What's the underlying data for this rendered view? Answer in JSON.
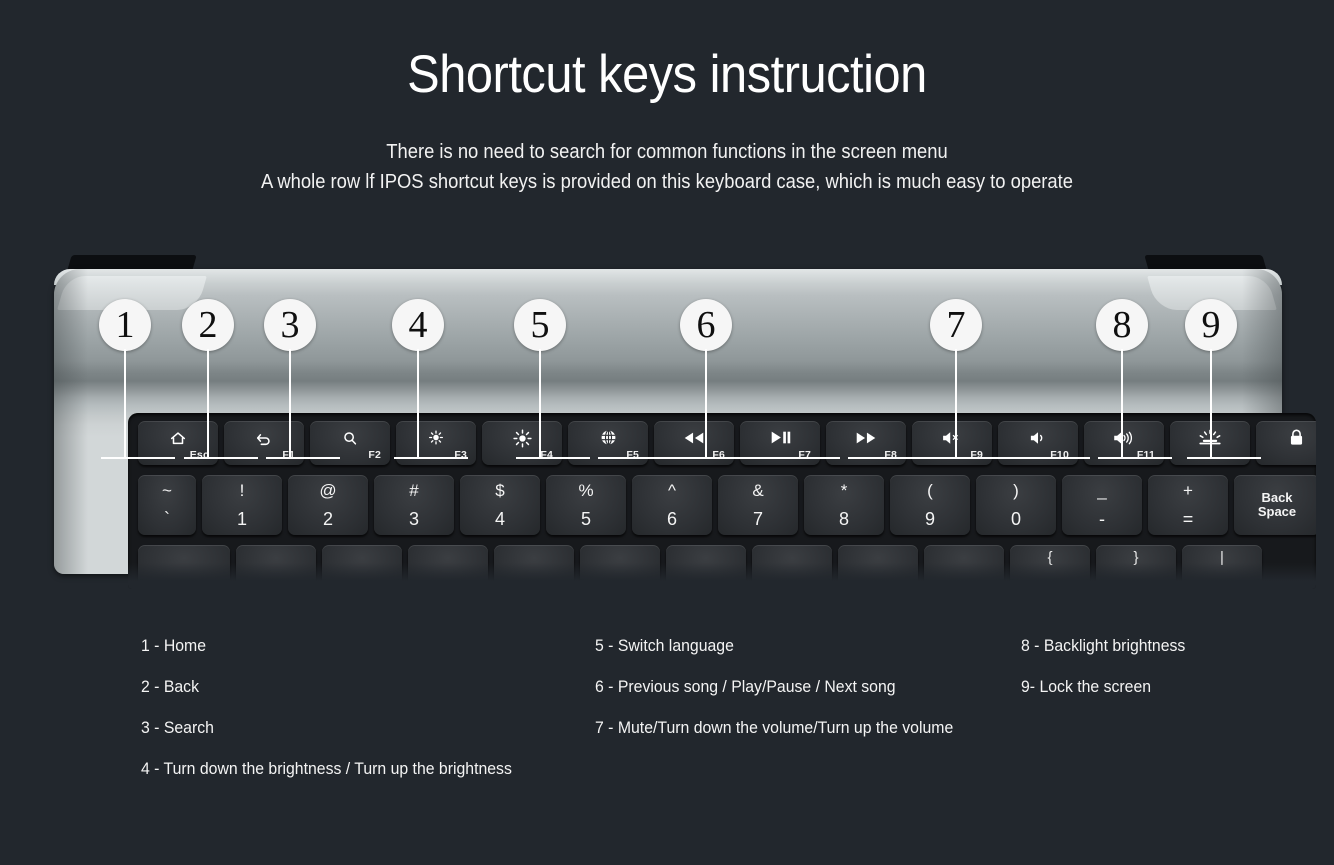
{
  "header": {
    "title": "Shortcut keys instruction",
    "subtitle_line1": "There is no need to search for common functions in the screen menu",
    "subtitle_line2": "A whole row lf IPOS shortcut keys is provided on this keyboard case, which is much easy to operate"
  },
  "colors": {
    "background": "#22272d",
    "text": "#ffffff",
    "callout_fill": "#f6f6f6",
    "callout_text": "#101010",
    "key_face": "#2e3135",
    "keyboard_body": "#b9bfc1",
    "deck": "#17191c"
  },
  "keyboard": {
    "function_row": [
      {
        "icon": "home-icon",
        "label": "Esc"
      },
      {
        "icon": "back-arrow-icon",
        "label": "F1"
      },
      {
        "icon": "search-icon",
        "label": "F2"
      },
      {
        "icon": "brightness-down-icon",
        "label": "F3"
      },
      {
        "icon": "brightness-up-icon",
        "label": "F4"
      },
      {
        "icon": "globe-icon",
        "label": "F5"
      },
      {
        "icon": "previous-track-icon",
        "label": "F6"
      },
      {
        "icon": "play-pause-icon",
        "label": "F7"
      },
      {
        "icon": "next-track-icon",
        "label": "F8"
      },
      {
        "icon": "volume-mute-icon",
        "label": "F9"
      },
      {
        "icon": "volume-down-icon",
        "label": "F10"
      },
      {
        "icon": "volume-up-icon",
        "label": "F11"
      },
      {
        "icon": "backlight-icon",
        "label": ""
      },
      {
        "icon": "lock-icon",
        "label": ""
      }
    ],
    "number_row": [
      {
        "top": "~",
        "bottom": "`"
      },
      {
        "top": "!",
        "bottom": "1"
      },
      {
        "top": "@",
        "bottom": "2"
      },
      {
        "top": "#",
        "bottom": "3"
      },
      {
        "top": "$",
        "bottom": "4"
      },
      {
        "top": "%",
        "bottom": "5"
      },
      {
        "top": "^",
        "bottom": "6"
      },
      {
        "top": "&",
        "bottom": "7"
      },
      {
        "top": "*",
        "bottom": "8"
      },
      {
        "top": "(",
        "bottom": "9"
      },
      {
        "top": ")",
        "bottom": "0"
      },
      {
        "top": "_",
        "bottom": "-"
      },
      {
        "top": "+",
        "bottom": "="
      }
    ],
    "backspace_line1": "Back",
    "backspace_line2": "Space",
    "qwerty_row_partial": [
      "",
      "",
      "",
      "",
      "",
      "",
      "",
      "",
      "",
      "",
      "{",
      "}",
      "|"
    ]
  },
  "callouts": [
    {
      "number": "1"
    },
    {
      "number": "2"
    },
    {
      "number": "3"
    },
    {
      "number": "4"
    },
    {
      "number": "5"
    },
    {
      "number": "6"
    },
    {
      "number": "7"
    },
    {
      "number": "8"
    },
    {
      "number": "9"
    }
  ],
  "legend": {
    "column1": [
      "1 - Home",
      "2 - Back",
      "3 - Search",
      "4 - Turn down the brightness  /  Turn up the brightness"
    ],
    "column2": [
      "5 - Switch language",
      "6 - Previous song  /  Play/Pause  /  Next song",
      "7 - Mute/Turn down the volume/Turn up the volume"
    ],
    "column3": [
      "8 - Backlight brightness",
      "9- Lock the screen"
    ]
  }
}
